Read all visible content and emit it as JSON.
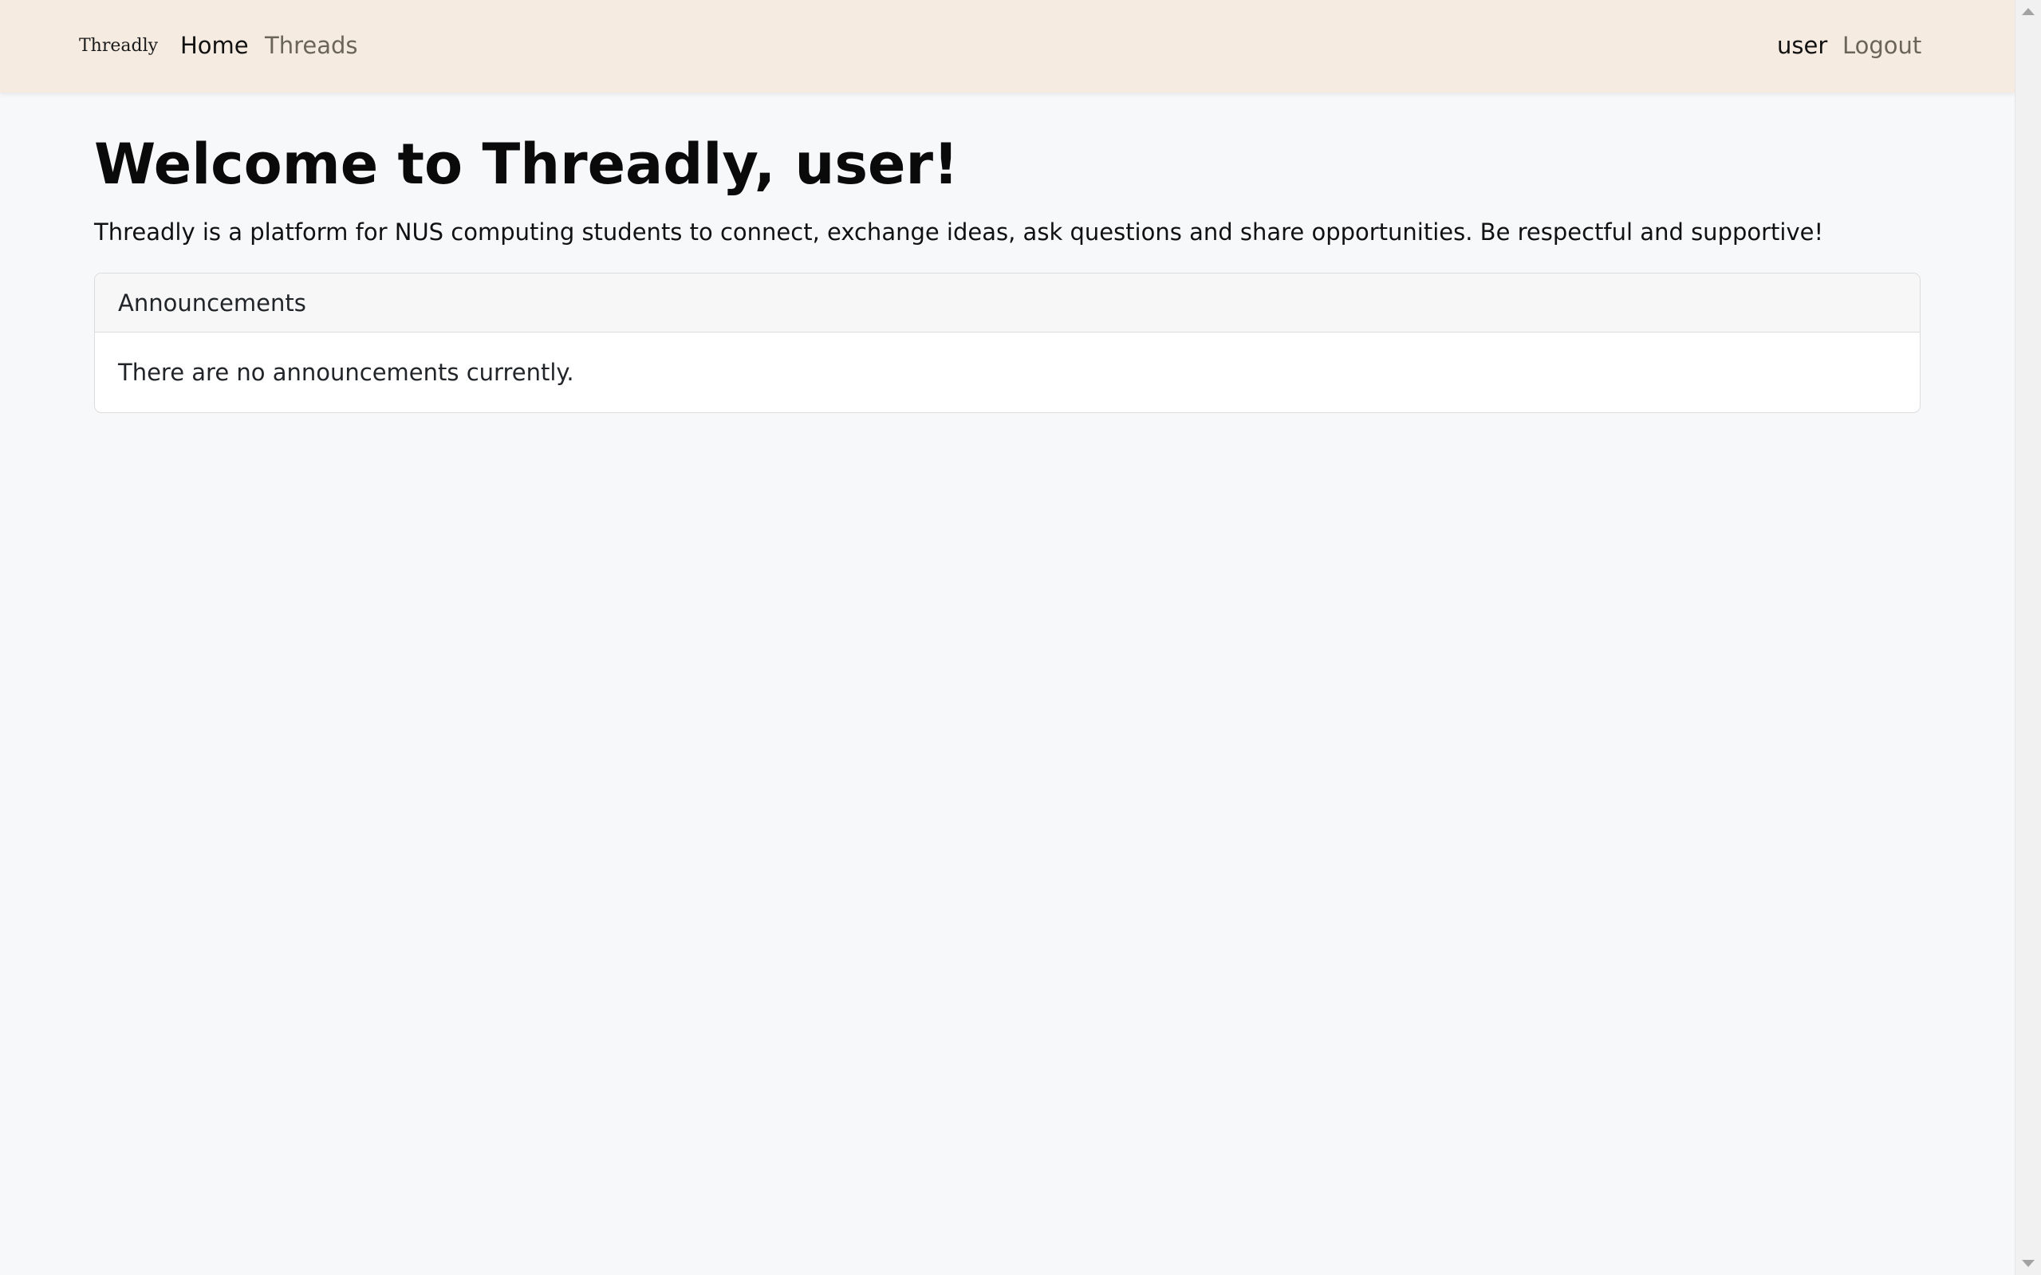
{
  "navbar": {
    "brand": "Threadly",
    "links": {
      "home": "Home",
      "threads": "Threads"
    },
    "user": "user",
    "logout": "Logout"
  },
  "main": {
    "title": "Welcome to Threadly, user!",
    "intro": "Threadly is a platform for NUS computing students to connect, exchange ideas, ask questions and share opportunities. Be respectful and supportive!",
    "announcements": {
      "header": "Announcements",
      "body": "There are no announcements currently."
    }
  },
  "colors": {
    "navbar_bg": "#f5ebe1",
    "page_bg": "#f7f8fa",
    "muted_link": "#6b6559"
  }
}
